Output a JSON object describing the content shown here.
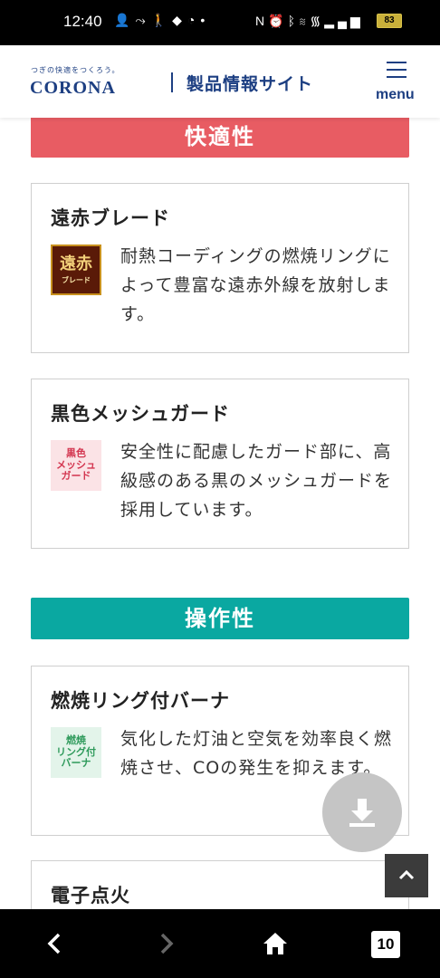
{
  "status_bar": {
    "time": "12:40",
    "battery": "83",
    "icons_left": [
      "person-icon",
      "route-icon",
      "walk-icon",
      "shield-icon",
      "timer-icon",
      "dot-icon"
    ],
    "icons_right": [
      "nfc-icon",
      "alarm-icon",
      "bluetooth-icon",
      "wifi-icon",
      "volte-icon",
      "signal-icon",
      "battery-icon"
    ]
  },
  "header": {
    "tagline": "つぎの快適をつくろう。",
    "logo": "CORONA",
    "site_title": "製品情報サイト",
    "menu_label": "menu"
  },
  "sections": [
    {
      "title": "快適性",
      "color": "#e85c63",
      "cards": [
        {
          "title": "遠赤ブレード",
          "icon_name": "enseki-blade-icon",
          "icon_lines": [
            "遠赤",
            "ブレード"
          ],
          "description": "耐熱コーディングの燃焼リングによって豊富な遠赤外線を放射します。"
        },
        {
          "title": "黒色メッシュガード",
          "icon_name": "mesh-guard-icon",
          "icon_lines": [
            "黒色",
            "メッシュ",
            "ガード"
          ],
          "description": "安全性に配慮したガード部に、高級感のある黒のメッシュガードを採用しています。"
        }
      ]
    },
    {
      "title": "操作性",
      "color": "#0aa8a1",
      "cards": [
        {
          "title": "燃焼リング付バーナ",
          "icon_name": "ring-burner-icon",
          "icon_lines": [
            "燃焼",
            "リング付",
            "バーナ"
          ],
          "description": "気化した灯油と空気を効率良く燃焼させ、COの発生を抑えます。"
        },
        {
          "title": "電子点火"
        }
      ]
    }
  ],
  "floating": {
    "download_icon": "download-icon",
    "back_to_top_icon": "chevron-up-icon"
  },
  "nav_bar": {
    "back_icon": "back-arrow-icon",
    "forward_icon": "forward-arrow-icon",
    "home_icon": "home-icon",
    "tabs_count": "10"
  }
}
